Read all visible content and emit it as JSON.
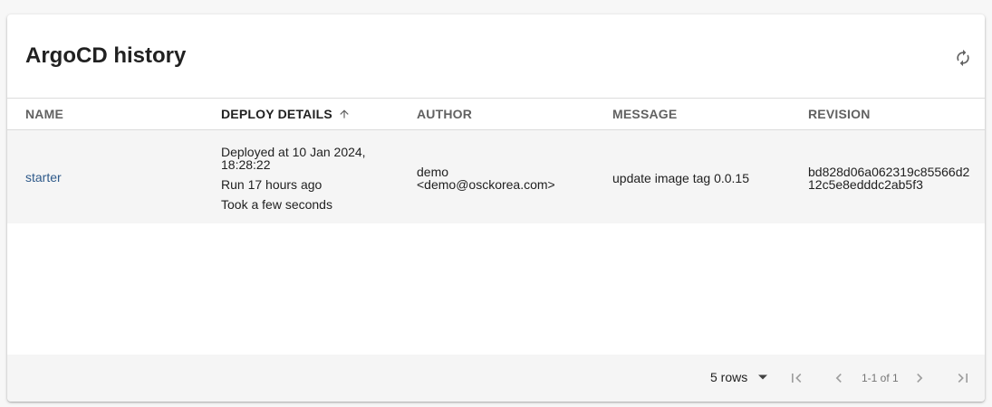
{
  "card": {
    "title": "ArgoCD history",
    "refresh_icon": "refresh-icon"
  },
  "table": {
    "columns": [
      {
        "label": "NAME"
      },
      {
        "label": "DEPLOY DETAILS",
        "sorted": "ascending"
      },
      {
        "label": "AUTHOR"
      },
      {
        "label": "MESSAGE"
      },
      {
        "label": "REVISION"
      }
    ],
    "rows": [
      {
        "name": "starter",
        "deploy_line1": "Deployed at 10 Jan 2024,",
        "deploy_line2": "18:28:22",
        "run": "Run 17 hours ago",
        "took": "Took a few seconds",
        "author_name": "demo",
        "author_email": "<demo@osckorea.com>",
        "message": "update image tag 0.0.15",
        "revision_line1": "bd828d06a062319c85566d2",
        "revision_line2": "12c5e8edddc2ab5f3"
      }
    ]
  },
  "pagination": {
    "rows_per_page": "5 rows",
    "page_info": "1-1 of 1"
  },
  "colors": {
    "link": "#2f5a8a",
    "row_background": "#f5f5f5",
    "header_text": "#616161"
  }
}
